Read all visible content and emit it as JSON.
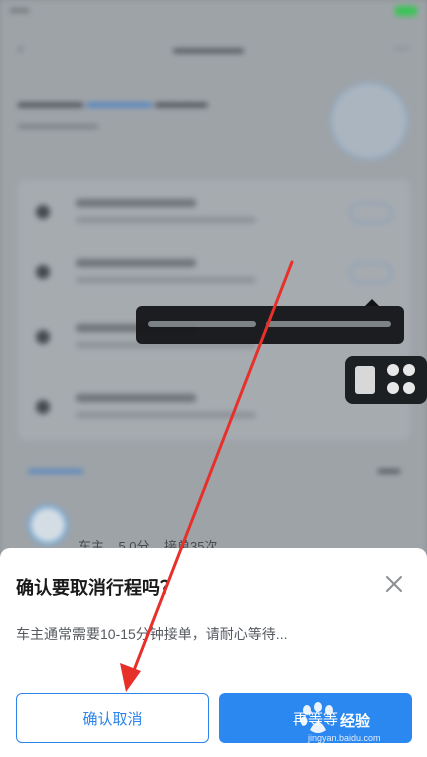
{
  "dialog": {
    "title": "确认要取消行程吗？",
    "message": "车主通常需要10-15分钟接单，请耐心等待...",
    "confirm_label": "确认取消",
    "wait_label": "再等等"
  },
  "driver_info": {
    "role": "车主",
    "rating": "5.0分",
    "orders": "接单35次"
  },
  "watermark": {
    "brand": "经验",
    "url": "jingyan.baidu.com"
  },
  "colors": {
    "accent": "#2a88f0",
    "annotation": "#e8302a",
    "sheet_bg": "#ffffff"
  },
  "icons": {
    "close": "close-icon"
  }
}
